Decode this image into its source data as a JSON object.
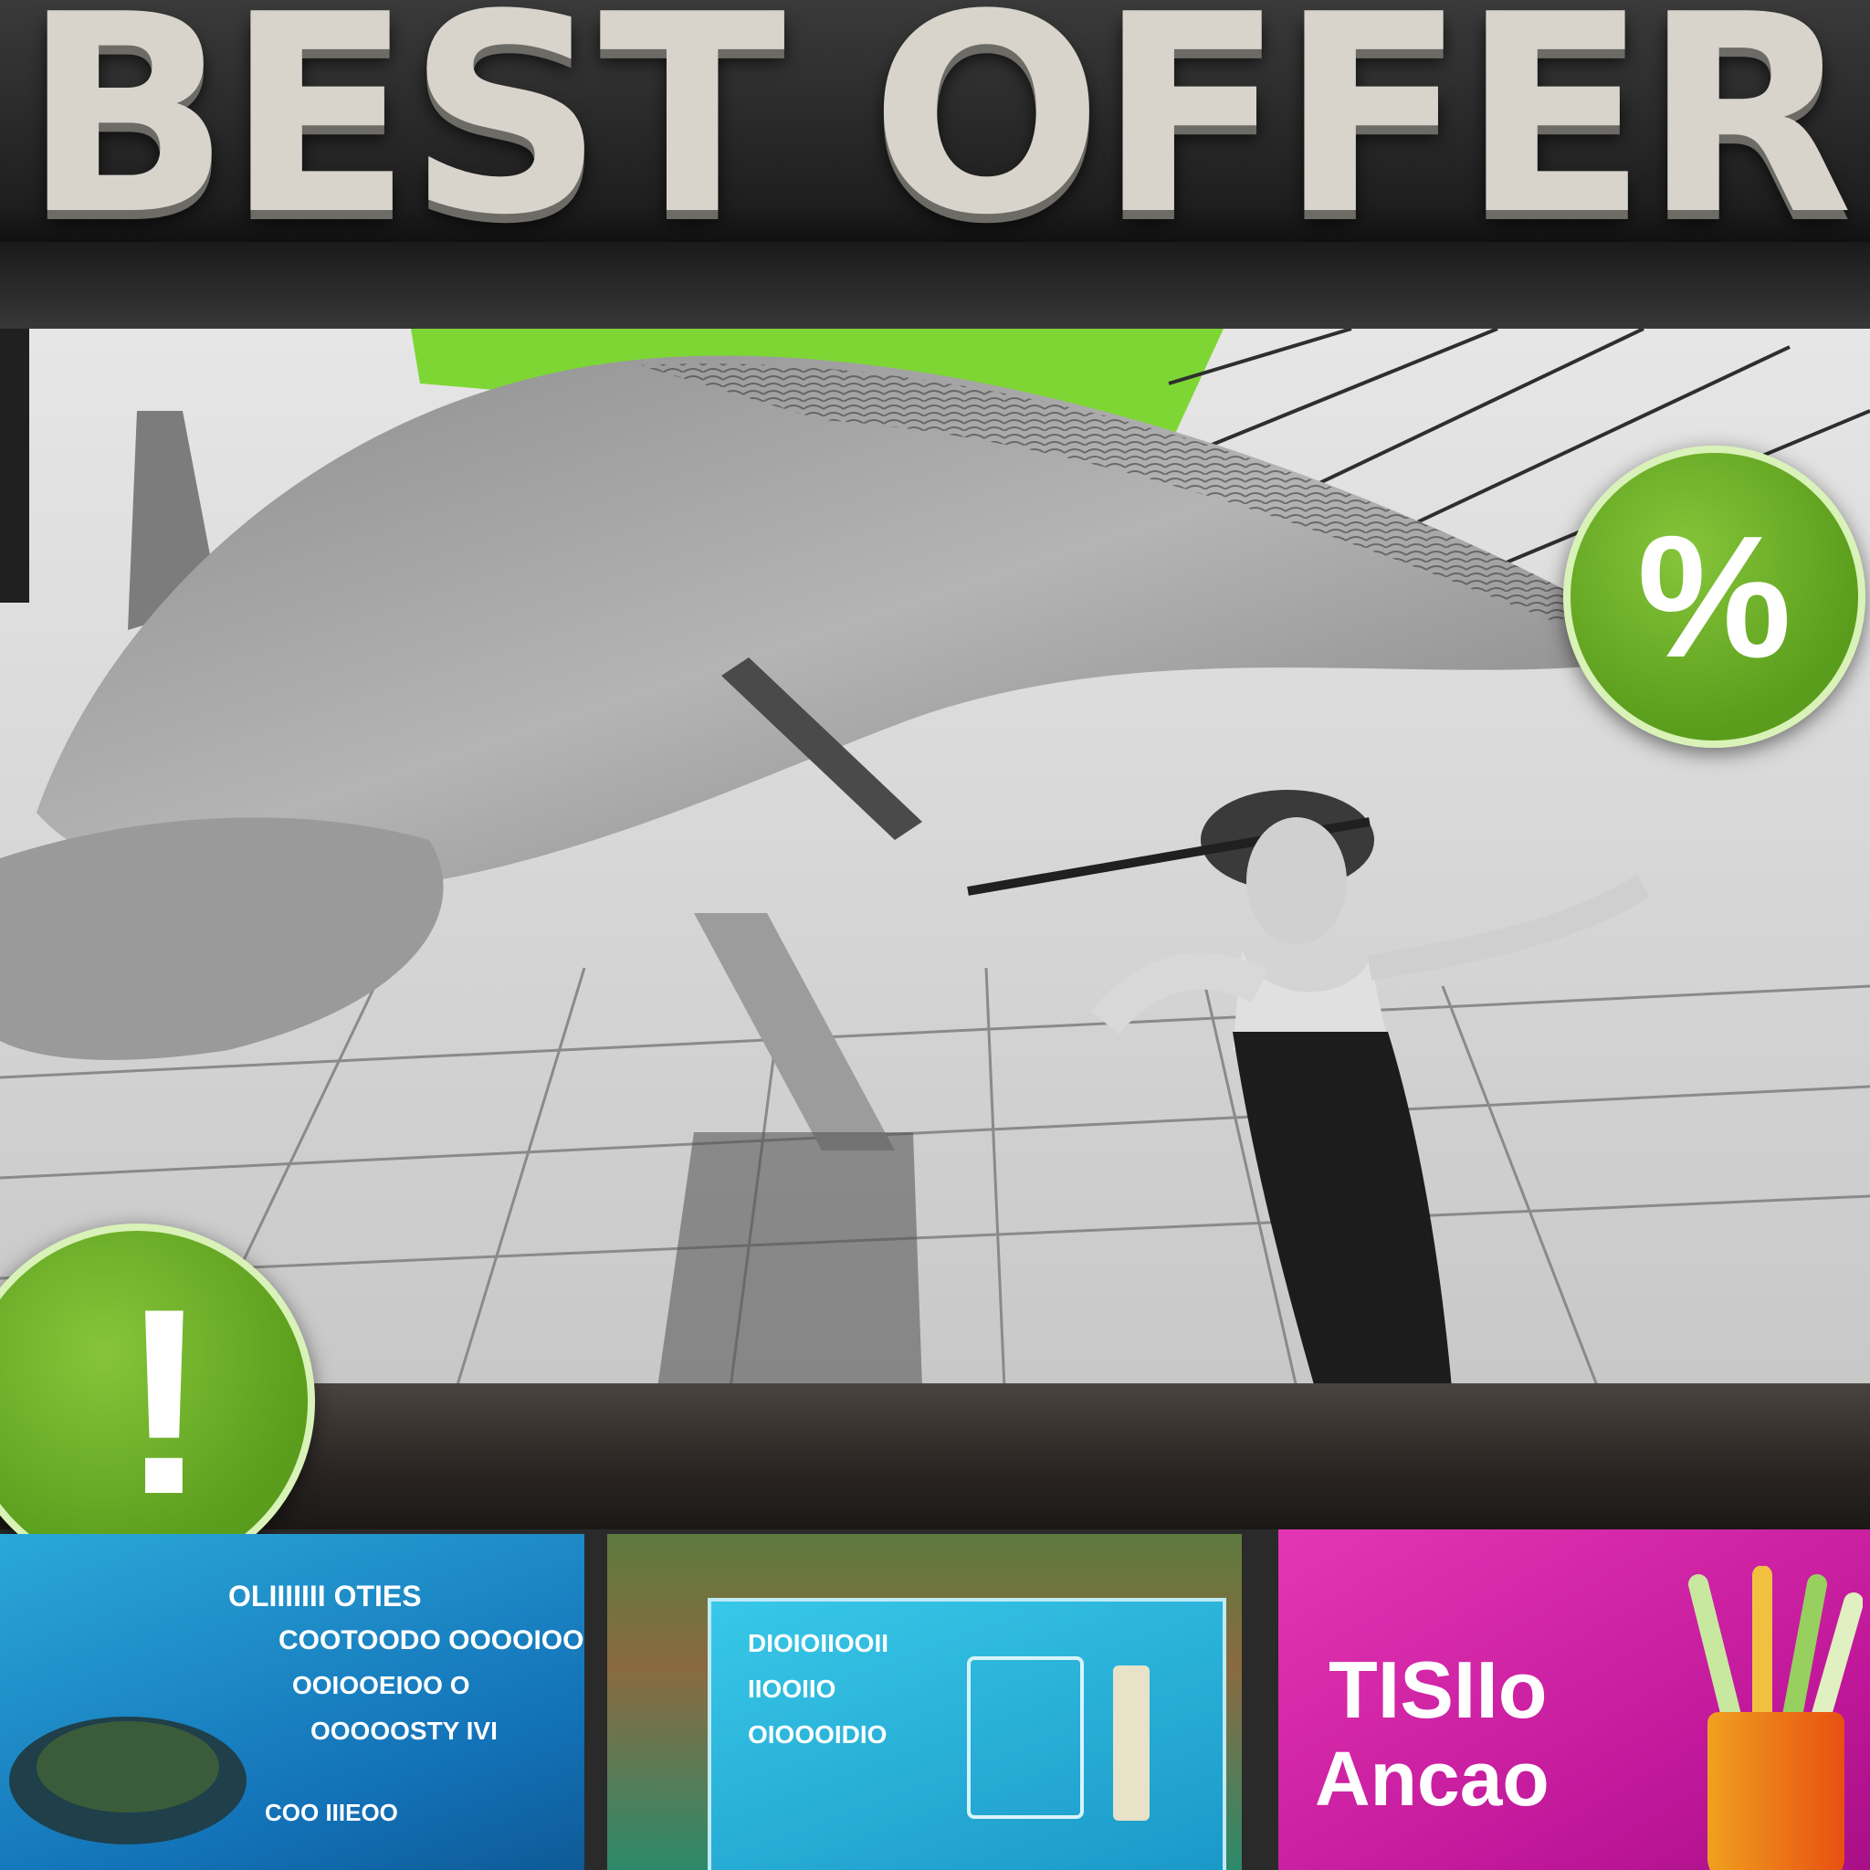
{
  "banner": {
    "title": "BEST OFFER"
  },
  "badges": {
    "percent_symbol": "%",
    "exclaim_symbol": "!"
  },
  "panels": {
    "left_lines": [
      "OLIIIIIII OTIES",
      "COOTOODO OOOOIOO",
      "OOIOOEIOO O",
      "OOOOOSTY IVI",
      "COO IIIEOO"
    ],
    "middle_lines": [
      "DIOIOIIOOII",
      "IIOOIIO",
      "OIOOOIDIO"
    ],
    "right_title_line1": "TISIIo",
    "right_title_line2": "Ancao"
  },
  "colors": {
    "accent_green": "#6cb52a",
    "banner_dark": "#1e1e1e",
    "panel_blue": "#1a8fcf",
    "panel_magenta": "#d21fa8"
  }
}
